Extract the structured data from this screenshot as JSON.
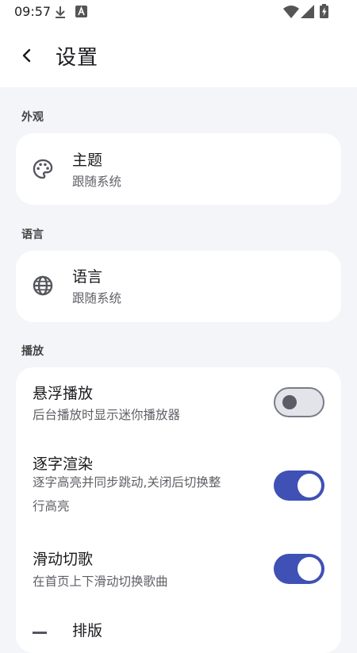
{
  "status_bar": {
    "time": "09:57"
  },
  "header": {
    "title": "设置"
  },
  "sections": {
    "appearance": {
      "title": "外观"
    },
    "language": {
      "title": "语言"
    },
    "playback": {
      "title": "播放"
    }
  },
  "appearance_items": {
    "theme": {
      "title": "主题",
      "subtitle": "跟随系统",
      "icon": "palette-icon"
    }
  },
  "language_items": {
    "language": {
      "title": "语言",
      "subtitle": "跟随系统",
      "icon": "globe-icon"
    }
  },
  "playback_items": {
    "floating": {
      "title": "悬浮播放",
      "subtitle": "后台播放时显示迷你播放器",
      "enabled": false
    },
    "word_render": {
      "title": "逐字渲染",
      "subtitle_line1": "逐字高亮并同步跳动,关闭后切换整",
      "subtitle_line2": "行高亮",
      "enabled": true
    },
    "swipe_switch": {
      "title": "滑动切歌",
      "subtitle": "在首页上下滑动切换歌曲",
      "enabled": true
    },
    "layout": {
      "title": "排版",
      "icon": "format-icon"
    }
  },
  "colors": {
    "accent": "#3f51b5",
    "background": "#f4f5f9",
    "card": "#ffffff"
  }
}
